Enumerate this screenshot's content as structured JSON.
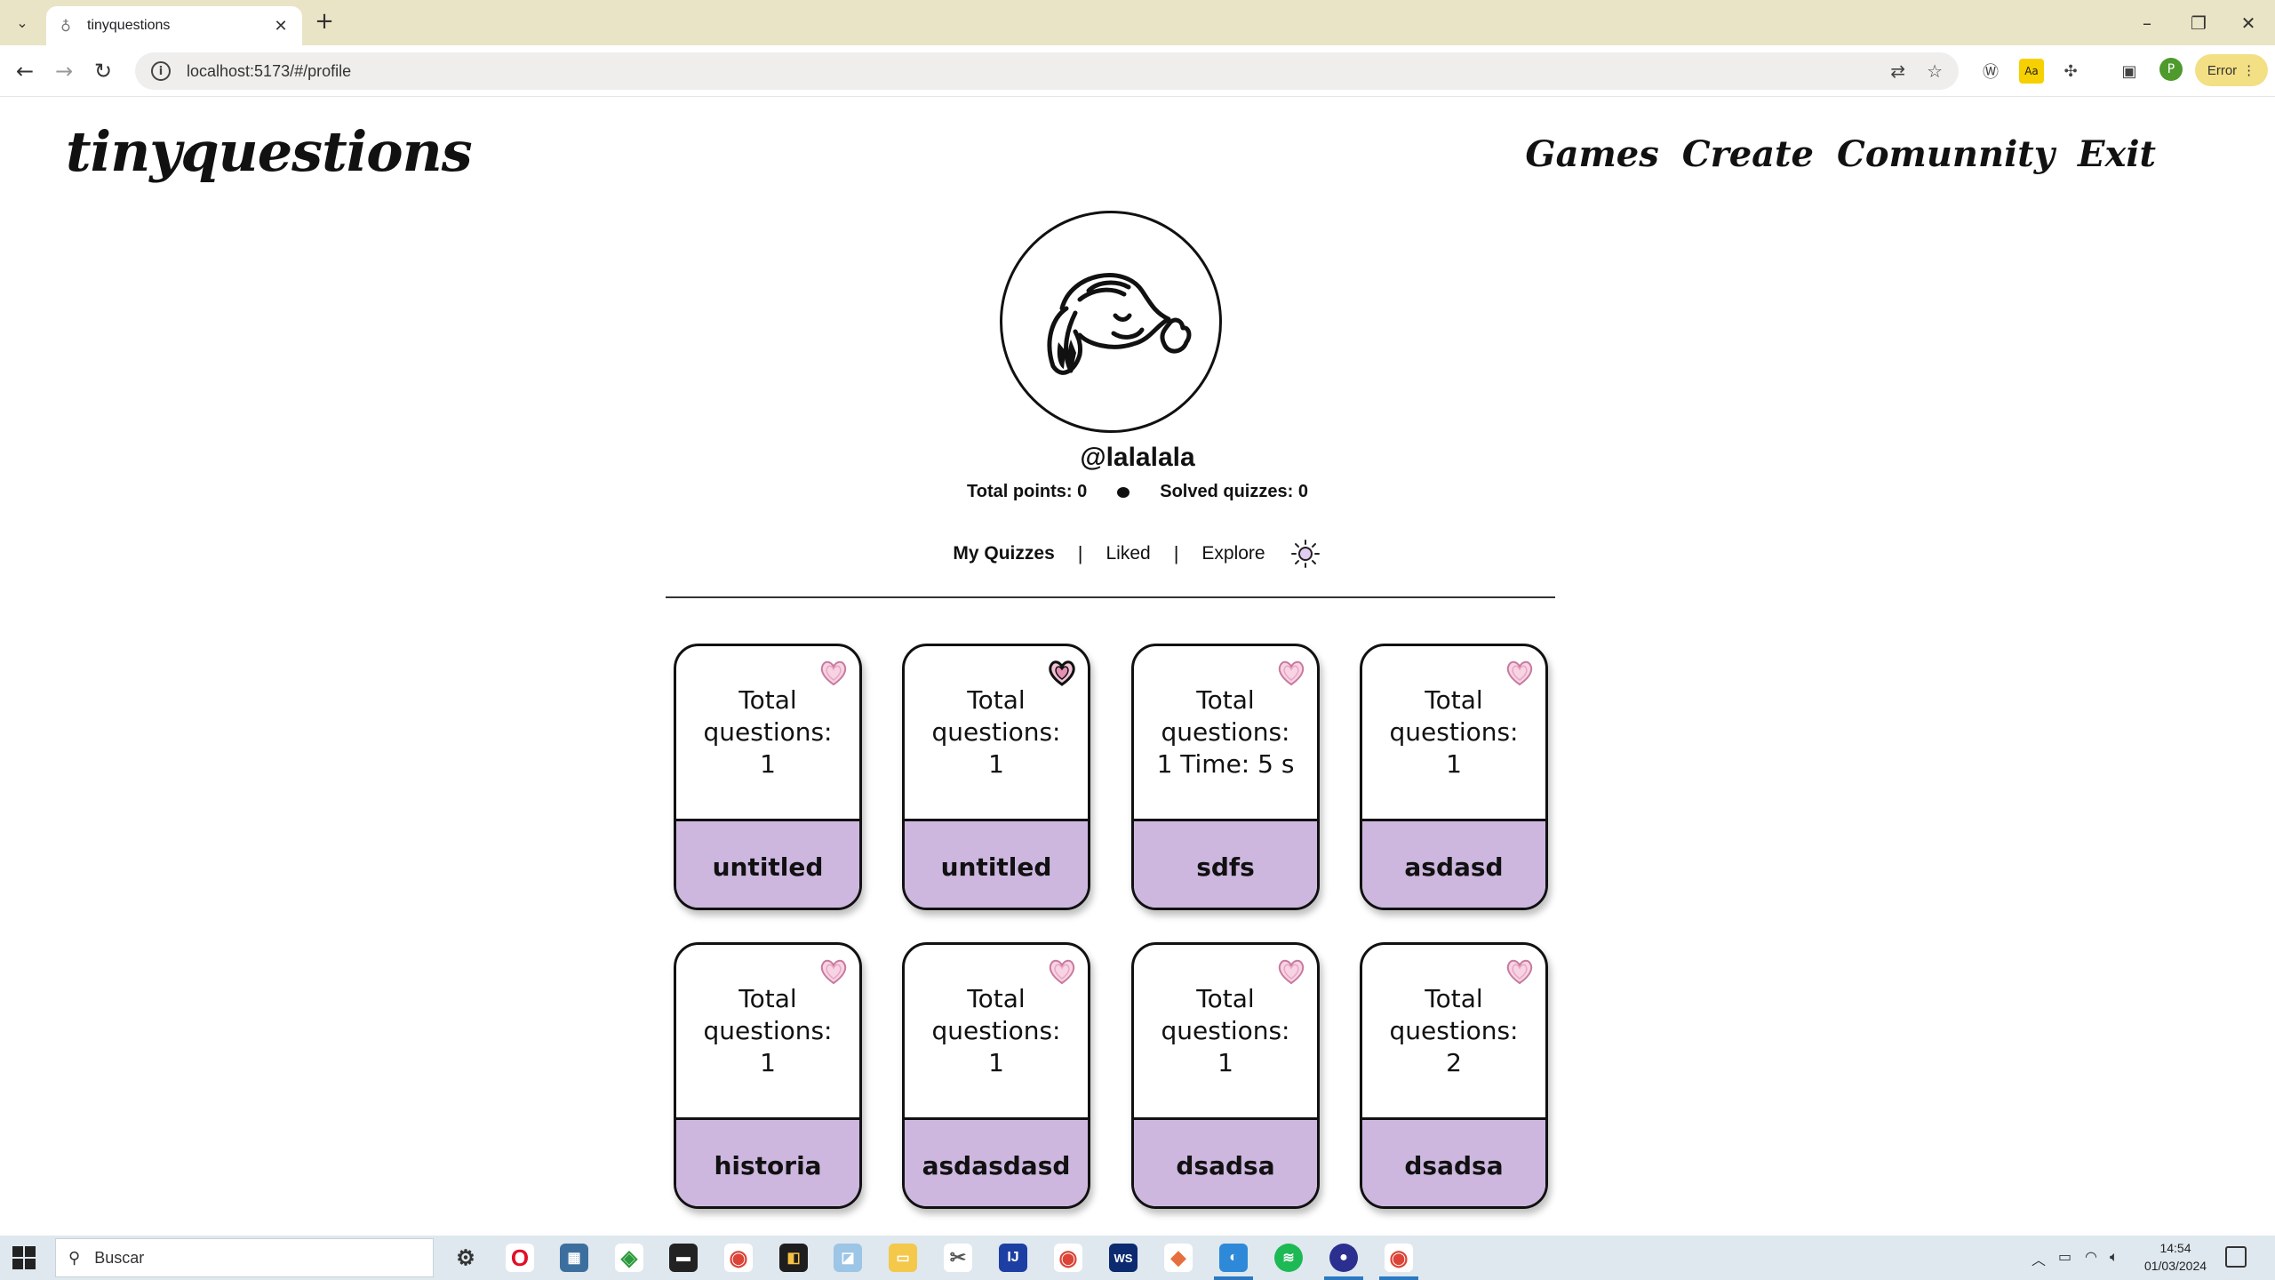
{
  "browser": {
    "tab_title": "tinyquestions",
    "url": "localhost:5173/#/profile",
    "error_label": "Error",
    "profile_initial": "P"
  },
  "site": {
    "logo": "tinyquestions",
    "nav": [
      "Games",
      "Create",
      "Comunnity",
      "Exit"
    ]
  },
  "profile": {
    "username": "@lalalala",
    "total_points": "Total points: 0",
    "solved_quizzes": "Solved quizzes: 0"
  },
  "tabs": {
    "my_quizzes": "My Quizzes",
    "liked": "Liked",
    "explore": "Explore",
    "separator": "|"
  },
  "quizzes": [
    {
      "info": "Total questions: 1",
      "name": "untitled",
      "liked": false
    },
    {
      "info": "Total questions: 1",
      "name": "untitled",
      "liked": true
    },
    {
      "info": "Total questions: 1 Time: 5 s",
      "name": "sdfs",
      "liked": false
    },
    {
      "info": "Total questions: 1",
      "name": "asdasd",
      "liked": false
    },
    {
      "info": "Total questions: 1",
      "name": "historia",
      "liked": false
    },
    {
      "info": "Total questions: 1",
      "name": "asdasdasd",
      "liked": false
    },
    {
      "info": "Total questions: 1",
      "name": "dsadsa",
      "liked": false
    },
    {
      "info": "Total questions: 2",
      "name": "dsadsa",
      "liked": false
    }
  ],
  "colors": {
    "card_footer": "#cdb7df",
    "heart_unliked": "#e8a6c4",
    "heart_liked": "#111111"
  },
  "taskbar": {
    "search_placeholder": "Buscar",
    "time": "14:54",
    "date": "01/03/2024"
  }
}
